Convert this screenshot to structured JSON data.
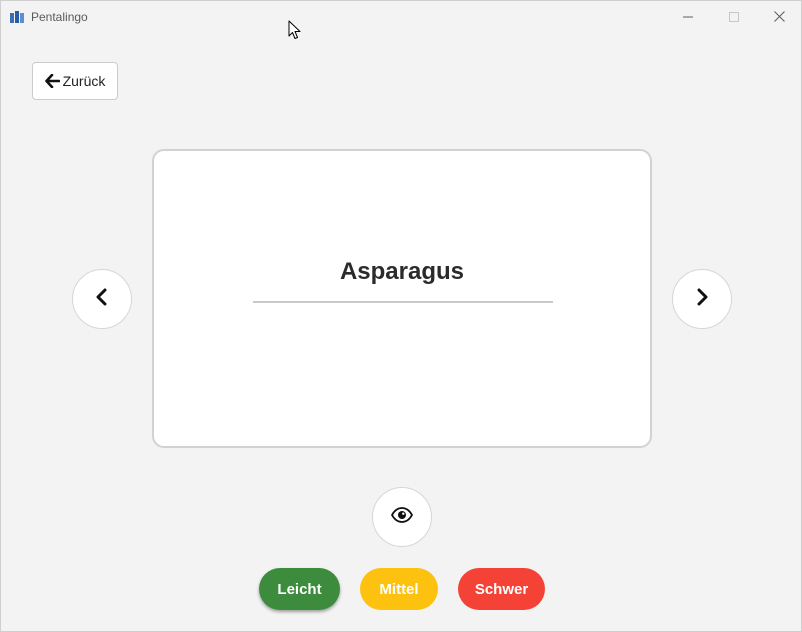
{
  "window": {
    "title": "Pentalingo",
    "icon": "app-icon",
    "controls": [
      "minimize-icon",
      "maximize-icon",
      "close-icon"
    ]
  },
  "toolbar": {
    "back_label": "Zurück",
    "back_icon": "arrow-left-icon"
  },
  "card": {
    "word": "Asparagus"
  },
  "navigation": {
    "prev_icon": "chevron-left-icon",
    "next_icon": "chevron-right-icon",
    "reveal_icon": "eye-icon"
  },
  "difficulty": {
    "easy_label": "Leicht",
    "medium_label": "Mittel",
    "hard_label": "Schwer"
  },
  "colors": {
    "easy": "#3d8b3d",
    "medium": "#fdc20f",
    "hard": "#f44336",
    "background": "#f3f3f3"
  }
}
